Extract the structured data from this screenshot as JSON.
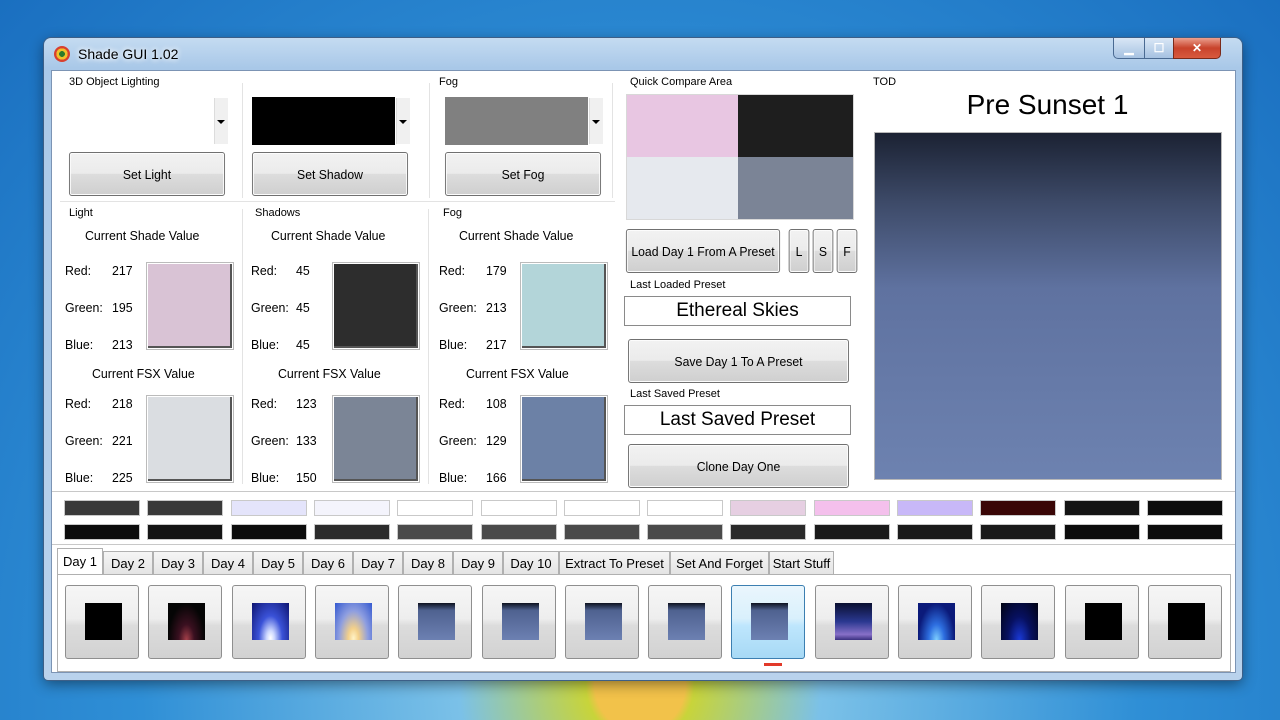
{
  "window": {
    "title": "Shade GUI 1.02",
    "minimize": "▁",
    "maximize": "☐",
    "close": "✕"
  },
  "lighting": {
    "group_title": "3D Object Lighting",
    "fog_group_title": "Fog",
    "set_light": "Set Light",
    "set_shadow": "Set Shadow",
    "set_fog": "Set Fog",
    "shadow_dropdown_color": "#000000",
    "fog_dropdown_color": "#808080"
  },
  "panels": [
    {
      "title": "Light",
      "shade_heading": "Current Shade Value",
      "fsx_heading": "Current FSX Value",
      "shade": {
        "red_label": "Red:",
        "red": "217",
        "green_label": "Green:",
        "green": "195",
        "blue_label": "Blue:",
        "blue": "213",
        "color": "#d9c3d5"
      },
      "fsx": {
        "red_label": "Red:",
        "red": "218",
        "green_label": "Green:",
        "green": "221",
        "blue_label": "Blue:",
        "blue": "225",
        "color": "#dadde1"
      }
    },
    {
      "title": "Shadows",
      "shade_heading": "Current Shade Value",
      "fsx_heading": "Current FSX Value",
      "shade": {
        "red_label": "Red:",
        "red": "45",
        "green_label": "Green:",
        "green": "45",
        "blue_label": "Blue:",
        "blue": "45",
        "color": "#2d2d2d"
      },
      "fsx": {
        "red_label": "Red:",
        "red": "123",
        "green_label": "Green:",
        "green": "133",
        "blue_label": "Blue:",
        "blue": "150",
        "color": "#7b8596"
      }
    },
    {
      "title": "Fog",
      "shade_heading": "Current Shade Value",
      "fsx_heading": "Current FSX Value",
      "shade": {
        "red_label": "Red:",
        "red": "179",
        "green_label": "Green:",
        "green": "213",
        "blue_label": "Blue:",
        "blue": "217",
        "color": "#b3d5d9"
      },
      "fsx": {
        "red_label": "Red:",
        "red": "108",
        "green_label": "Green:",
        "green": "129",
        "blue_label": "Blue:",
        "blue": "166",
        "color": "#6c81a6"
      }
    }
  ],
  "quick_compare": {
    "title": "Quick Compare Area",
    "colors": [
      "#e8c6e2",
      "#1e1e1e",
      "#e6e9ee",
      "#7b8496"
    ],
    "load_button": "Load Day 1 From A Preset",
    "l_button": "L",
    "s_button": "S",
    "f_button": "F",
    "last_loaded_label": "Last Loaded Preset",
    "last_loaded_value": "Ethereal Skies",
    "save_button": "Save Day 1 To A Preset",
    "last_saved_label": "Last Saved Preset",
    "last_saved_value": "Last Saved Preset",
    "clone_button": "Clone Day One"
  },
  "tod": {
    "title": "TOD",
    "heading": "Pre Sunset 1",
    "sky_top": "#1b2233",
    "sky_bottom": "#6d82b0"
  },
  "color_strips": {
    "top": [
      "#3a3a3a",
      "#3a3a3a",
      "#e4e4fb",
      "#f4f4fc",
      "#ffffff",
      "#ffffff",
      "#ffffff",
      "#ffffff",
      "#e6cfe2",
      "#f4c0ec",
      "#c8b8f8",
      "#3a0606",
      "#141414",
      "#0c0c0c"
    ],
    "bottom": [
      "#0c0c0c",
      "#141414",
      "#0c0c0c",
      "#2b2b2b",
      "#4a4a4a",
      "#4a4a4a",
      "#4a4a4a",
      "#4a4a4a",
      "#2a2a2a",
      "#1a1a1a",
      "#1a1a1a",
      "#1a1a1a",
      "#0c0c0c",
      "#0c0c0c"
    ]
  },
  "tabs": [
    "Day 1",
    "Day 2",
    "Day 3",
    "Day 4",
    "Day 5",
    "Day 6",
    "Day 7",
    "Day 8",
    "Day 9",
    "Day 10",
    "Extract To Preset",
    "Set And Forget",
    "Start Stuff"
  ],
  "active_tab": "Day 1",
  "thumbnails": [
    {
      "kind": "black"
    },
    {
      "kind": "dusk-red"
    },
    {
      "kind": "sunrise-blue"
    },
    {
      "kind": "sunrise-gold"
    },
    {
      "kind": "day"
    },
    {
      "kind": "day"
    },
    {
      "kind": "day"
    },
    {
      "kind": "day"
    },
    {
      "kind": "day"
    },
    {
      "kind": "sunset-violet"
    },
    {
      "kind": "dusk-blue"
    },
    {
      "kind": "night-blue"
    },
    {
      "kind": "black"
    },
    {
      "kind": "black"
    }
  ]
}
